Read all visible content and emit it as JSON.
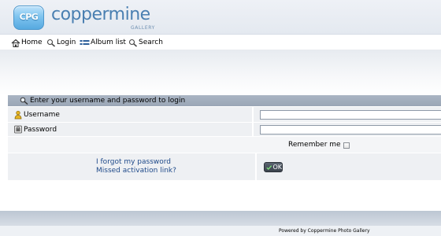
{
  "logo": {
    "badge": "CPG",
    "wordmark": "coppermine",
    "subtitle": "GALLERY"
  },
  "nav": {
    "items": [
      {
        "label": "Home",
        "icon": "home-icon"
      },
      {
        "label": "Login",
        "icon": "magnifier-key-icon"
      },
      {
        "label": "Album list",
        "icon": "album-list-icon"
      },
      {
        "label": "Search",
        "icon": "search-icon"
      }
    ]
  },
  "login": {
    "title": "Enter your username and password to login",
    "username_label": "Username",
    "password_label": "Password",
    "username_value": "",
    "password_value": "",
    "remember_label": "Remember me",
    "remember_checked": false,
    "forgot_password": "I forgot my password",
    "missed_activation": "Missed activation link?",
    "ok_label": "OK"
  },
  "footer": {
    "powered_by": "Powered by Coppermine Photo Gallery"
  },
  "colors": {
    "accent": "#4a7fb1",
    "link": "#1f4a8a",
    "title_bar": "#9aa6b6",
    "row_bg": "#eef0f3"
  }
}
